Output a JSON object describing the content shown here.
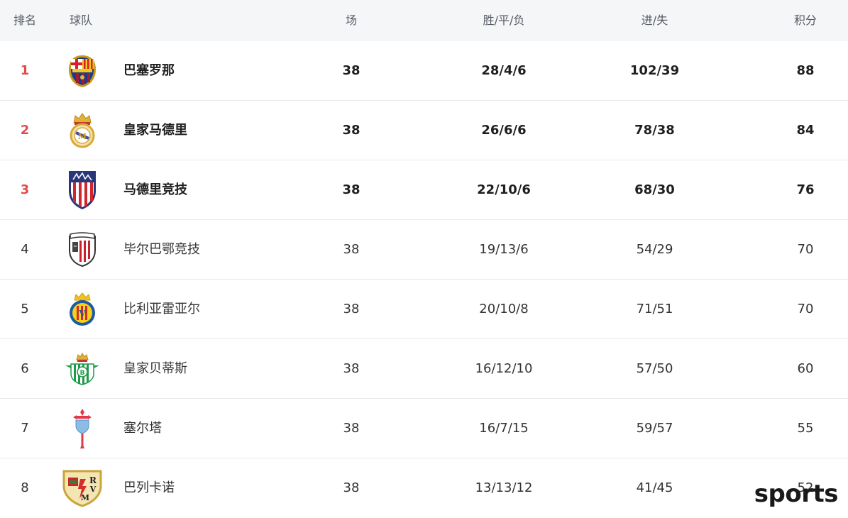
{
  "header": {
    "rank": "排名",
    "team": "球队",
    "played": "场",
    "wdl": "胜/平/负",
    "goals": "进/失",
    "points": "积分"
  },
  "rows": [
    {
      "rank": "1",
      "team": "巴塞罗那",
      "played": "38",
      "wdl": "28/4/6",
      "goals": "102/39",
      "points": "88",
      "logo": "barcelona-crest-icon"
    },
    {
      "rank": "2",
      "team": "皇家马德里",
      "played": "38",
      "wdl": "26/6/6",
      "goals": "78/38",
      "points": "84",
      "logo": "real-madrid-crest-icon"
    },
    {
      "rank": "3",
      "team": "马德里竞技",
      "played": "38",
      "wdl": "22/10/6",
      "goals": "68/30",
      "points": "76",
      "logo": "atletico-madrid-crest-icon"
    },
    {
      "rank": "4",
      "team": "毕尔巴鄂竞技",
      "played": "38",
      "wdl": "19/13/6",
      "goals": "54/29",
      "points": "70",
      "logo": "athletic-club-crest-icon"
    },
    {
      "rank": "5",
      "team": "比利亚雷亚尔",
      "played": "38",
      "wdl": "20/10/8",
      "goals": "71/51",
      "points": "70",
      "logo": "villarreal-crest-icon"
    },
    {
      "rank": "6",
      "team": "皇家贝蒂斯",
      "played": "38",
      "wdl": "16/12/10",
      "goals": "57/50",
      "points": "60",
      "logo": "real-betis-crest-icon"
    },
    {
      "rank": "7",
      "team": "塞尔塔",
      "played": "38",
      "wdl": "16/7/15",
      "goals": "59/57",
      "points": "55",
      "logo": "celta-vigo-crest-icon"
    },
    {
      "rank": "8",
      "team": "巴列卡诺",
      "played": "38",
      "wdl": "13/13/12",
      "goals": "41/45",
      "points": "52",
      "logo": "rayo-vallecano-crest-icon"
    }
  ],
  "watermark": "sports",
  "colors": {
    "header_bg": "#f5f6f8",
    "rank_highlight": "#e34b4b",
    "row_divider": "#e8e9ec"
  }
}
